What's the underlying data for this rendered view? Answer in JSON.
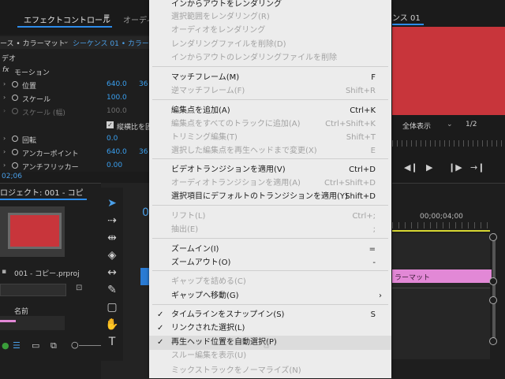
{
  "effect_controls": {
    "tab_effect_controls": "エフェクトコントロール",
    "tab_menu_icon": "≡",
    "tab_audio_partial": "オーディ",
    "source_clip": "ース • カラーマット",
    "sequence": "シーケンス 01 • カラーマ",
    "video_label": "デオ",
    "fx_label": "fx",
    "motion_label": "モーション",
    "position_label": "位置",
    "position_x": "640.0",
    "position_y": "36",
    "scale_label": "スケール",
    "scale_value": "100.0",
    "scale_width_label": "スケール (幅)",
    "scale_width_value": "100.0",
    "uniform_scale_label": "縦横比を固",
    "rotation_label": "回転",
    "rotation_value": "0.0",
    "anchor_label": "アンカーポイント",
    "anchor_x": "640.0",
    "anchor_y": "36",
    "antiflicker_label": "アンチフリッカー",
    "antiflicker_value": "0.00",
    "timecode": "02;06"
  },
  "project": {
    "title": "ロジェクト: 001 - コピ",
    "file_name": "001 - コピー.prproj",
    "column_name": "名前"
  },
  "sequence_panel": {
    "timecode_partial": "0"
  },
  "program_monitor": {
    "tab_label": "ンス 01",
    "zoom_label": "全体表示",
    "resolution": "1/2"
  },
  "timeline": {
    "timecode": "00;00;04;00",
    "clip_label": "ラーマット"
  },
  "context_menu": {
    "items": [
      {
        "label": "インからアウトをレンダリング",
        "shortcut": "",
        "enabled": true,
        "checked": false
      },
      {
        "label": "選択範囲をレンダリング(R)",
        "shortcut": "",
        "enabled": false,
        "checked": false
      },
      {
        "label": "オーディオをレンダリング",
        "shortcut": "",
        "enabled": false,
        "checked": false
      },
      {
        "label": "レンダリングファイルを削除(D)",
        "shortcut": "",
        "enabled": false,
        "checked": false
      },
      {
        "label": "インからアウトのレンダリングファイルを削除",
        "shortcut": "",
        "enabled": false,
        "checked": false
      },
      {
        "label": "マッチフレーム(M)",
        "shortcut": "F",
        "enabled": true,
        "checked": false
      },
      {
        "label": "逆マッチフレーム(F)",
        "shortcut": "Shift+R",
        "enabled": false,
        "checked": false
      },
      {
        "label": "編集点を追加(A)",
        "shortcut": "Ctrl+K",
        "enabled": true,
        "checked": false
      },
      {
        "label": "編集点をすべてのトラックに追加(A)",
        "shortcut": "Ctrl+Shift+K",
        "enabled": false,
        "checked": false
      },
      {
        "label": "トリミング編集(T)",
        "shortcut": "Shift+T",
        "enabled": false,
        "checked": false
      },
      {
        "label": "選択した編集点を再生ヘッドまで変更(X)",
        "shortcut": "E",
        "enabled": false,
        "checked": false
      },
      {
        "label": "ビデオトランジションを適用(V)",
        "shortcut": "Ctrl+D",
        "enabled": true,
        "checked": false
      },
      {
        "label": "オーディオトランジションを適用(A)",
        "shortcut": "Ctrl+Shift+D",
        "enabled": false,
        "checked": false
      },
      {
        "label": "選択項目にデフォルトのトランジションを適用(Y)",
        "shortcut": "Shift+D",
        "enabled": true,
        "checked": false
      },
      {
        "label": "リフト(L)",
        "shortcut": "Ctrl+;",
        "enabled": false,
        "checked": false
      },
      {
        "label": "抽出(E)",
        "shortcut": ";",
        "enabled": false,
        "checked": false
      },
      {
        "label": "ズームイン(I)",
        "shortcut": "=",
        "enabled": true,
        "checked": false
      },
      {
        "label": "ズームアウト(O)",
        "shortcut": "-",
        "enabled": true,
        "checked": false
      },
      {
        "label": "ギャップを詰める(C)",
        "shortcut": "",
        "enabled": false,
        "checked": false
      },
      {
        "label": "ギャップへ移動(G)",
        "shortcut": "",
        "enabled": true,
        "checked": false,
        "submenu": "›"
      },
      {
        "label": "タイムラインをスナップイン(S)",
        "shortcut": "S",
        "enabled": true,
        "checked": true
      },
      {
        "label": "リンクされた選択(L)",
        "shortcut": "",
        "enabled": true,
        "checked": true
      },
      {
        "label": "再生ヘッド位置を自動選択(P)",
        "shortcut": "",
        "enabled": true,
        "checked": true,
        "highlighted": true
      },
      {
        "label": "スルー編集を表示(U)",
        "shortcut": "",
        "enabled": false,
        "checked": false
      },
      {
        "label": "ミックストラックをノーマライズ(N)",
        "shortcut": "",
        "enabled": false,
        "checked": false
      }
    ],
    "check_mark": "✓"
  },
  "colors": {
    "menu_bg": "#ececec",
    "accent_blue": "#2d8ceb",
    "clip_red": "#c8353b",
    "clip_pink": "#e288d6"
  }
}
